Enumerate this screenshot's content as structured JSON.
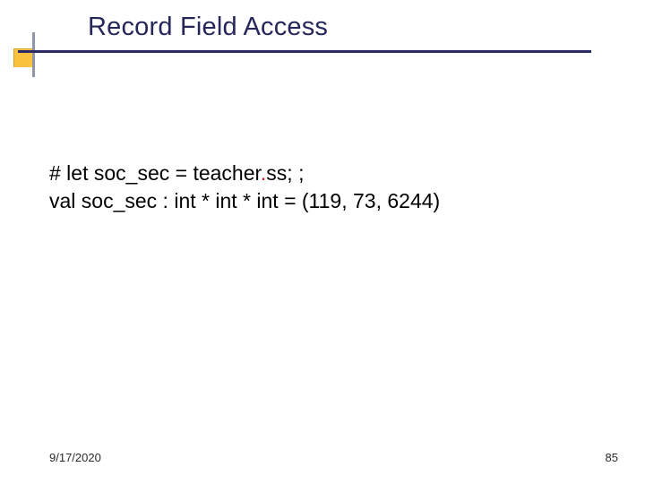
{
  "slide": {
    "title": "Record Field Access",
    "code": {
      "line1_part1": "# let soc_sec = teacher",
      "line1_dot": ".",
      "line1_part2": "ss; ;",
      "line2": "val soc_sec : int * int * int = (119, 73, 6244)"
    },
    "footer": {
      "date": "9/17/2020",
      "page": "85"
    }
  }
}
